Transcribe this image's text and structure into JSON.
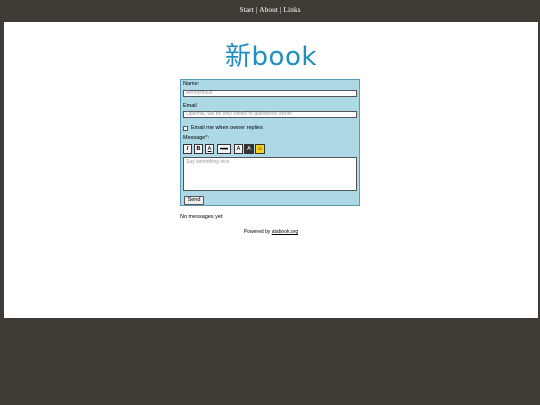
{
  "nav": {
    "items": [
      "Start",
      "About",
      "Links"
    ],
    "separator": "|"
  },
  "logo": {
    "text": "新book"
  },
  "form": {
    "name_label": "Name:",
    "name_placeholder": "Anonymous",
    "email_label": "Email",
    "email_placeholder": "Optional, will be only visible to guestbook owner",
    "notify_label": "Email me when owner replies",
    "message_label": "Message*:",
    "toolbar": {
      "italic": "I",
      "bold": "B",
      "underline": "A",
      "strike": "Aaa",
      "font": "A",
      "color": "A",
      "smiley": "☺"
    },
    "message_placeholder": "Say something nice",
    "send_label": "Send"
  },
  "messages": {
    "empty_text": "No messages yet"
  },
  "footer": {
    "powered_prefix": "Powered by",
    "powered_link": "atabook.org"
  },
  "colors": {
    "background": "#403c35",
    "form_bg": "#add8e6",
    "logo": "#1f8fbf"
  }
}
